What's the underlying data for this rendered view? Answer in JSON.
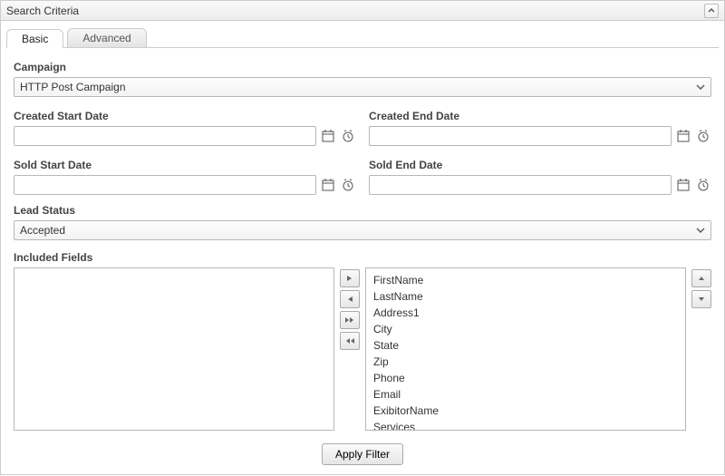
{
  "panel": {
    "title": "Search Criteria"
  },
  "tabs": {
    "basic": "Basic",
    "advanced": "Advanced"
  },
  "campaign": {
    "label": "Campaign",
    "value": "HTTP Post Campaign"
  },
  "dates": {
    "createdStart": {
      "label": "Created Start Date",
      "value": ""
    },
    "createdEnd": {
      "label": "Created End Date",
      "value": ""
    },
    "soldStart": {
      "label": "Sold Start Date",
      "value": ""
    },
    "soldEnd": {
      "label": "Sold End Date",
      "value": ""
    }
  },
  "leadStatus": {
    "label": "Lead Status",
    "value": "Accepted"
  },
  "includedFields": {
    "label": "Included Fields",
    "available": [],
    "selected": [
      "FirstName",
      "LastName",
      "Address1",
      "City",
      "State",
      "Zip",
      "Phone",
      "Email",
      "ExibitorName",
      "Services"
    ]
  },
  "buttons": {
    "applyFilter": "Apply Filter"
  }
}
